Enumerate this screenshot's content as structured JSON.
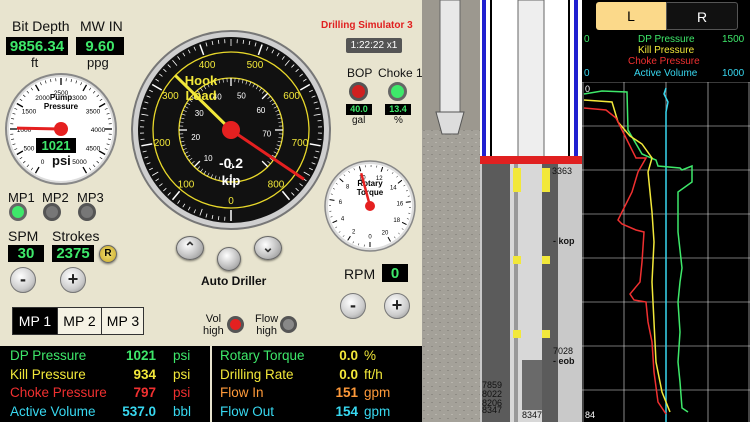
{
  "left": {
    "bit_depth_label": "Bit Depth",
    "bit_depth_value": "9856.34",
    "bit_depth_unit": "ft",
    "mw_label": "MW IN",
    "mw_value": "9.60",
    "mw_unit": "ppg",
    "pump_gauge_title": "Pump\nPressure",
    "pump_gauge_value": "1021",
    "pump_gauge_unit": "psi",
    "pump_ticks": [
      "0",
      "500",
      "1000",
      "1500",
      "2000",
      "2500",
      "3000",
      "3500",
      "4000",
      "4500",
      "5000"
    ],
    "pump_needle": 0.204,
    "mp_leds": [
      "MP1",
      "MP2",
      "MP3"
    ],
    "spm_label": "SPM",
    "spm_value": "30",
    "strokes_label": "Strokes",
    "strokes_value": "2375",
    "reset_label": "R",
    "minus": "-",
    "plus": "+",
    "mp_tabs": [
      "MP 1",
      "MP 2",
      "MP 3"
    ]
  },
  "hook": {
    "title": "Hook\nLoad",
    "value": "-0.2",
    "unit": "kip",
    "outer_ticks": [
      "0",
      "100",
      "200",
      "300",
      "400",
      "500",
      "600",
      "700",
      "800"
    ],
    "inner_ticks": [
      "0",
      "10",
      "20",
      "30",
      "40",
      "50",
      "60",
      "70"
    ],
    "needle_outer": 0.42,
    "needle_inner": 0.95,
    "auto_driller": "Auto Driller"
  },
  "header": {
    "sim_title": "Drilling Simulator 3",
    "clock": "1:22:22 x1"
  },
  "bop": {
    "bop_label": "BOP",
    "bop_value": "40.0",
    "bop_unit": "gal",
    "choke_label": "Choke 1",
    "choke_value": "13.4",
    "choke_unit": "%"
  },
  "rotary": {
    "title": "Rotary\nTorque",
    "ticks": [
      "0",
      "2",
      "4",
      "6",
      "8",
      "10",
      "12",
      "14",
      "16",
      "18",
      "20"
    ],
    "needle": 0.5,
    "rpm_label": "RPM",
    "rpm_value": "0"
  },
  "alarms": {
    "vol_high": "Vol\nhigh",
    "flow_high": "Flow\nhigh"
  },
  "readouts_left": [
    {
      "label": "DP Pressure",
      "value": "1021",
      "unit": "psi",
      "color": "#3ee86a"
    },
    {
      "label": "Kill Pressure",
      "value": "934",
      "unit": "psi",
      "color": "#f2e83a"
    },
    {
      "label": "Choke Pressure",
      "value": "797",
      "unit": "psi",
      "color": "#f03030"
    },
    {
      "label": "Active Volume",
      "value": "537.0",
      "unit": "bbl",
      "color": "#38d8f0"
    }
  ],
  "readouts_right": [
    {
      "label": "Rotary Torque",
      "value": "0.0",
      "unit": "%",
      "color": "#3ee86a",
      "vcolor": "#f2e83a"
    },
    {
      "label": "Drilling Rate",
      "value": "0.0",
      "unit": "ft/h",
      "color": "#f2e83a",
      "vcolor": "#f2e83a"
    },
    {
      "label": "Flow In",
      "value": "151",
      "unit": "gpm",
      "color": "#ff9a3a",
      "vcolor": "#ff9a3a"
    },
    {
      "label": "Flow Out",
      "value": "154",
      "unit": "gpm",
      "color": "#38d8f0",
      "vcolor": "#38d8f0"
    }
  ],
  "well": {
    "depth_top": "3363",
    "kop": "- kop",
    "depth_mid": "7028",
    "eob": "- eob",
    "depth_left": [
      "7859",
      "8022",
      "8206",
      "8347"
    ],
    "depth_bottom": "8347"
  },
  "trend": {
    "tab_l": "L",
    "tab_r": "R",
    "scale_left": "0",
    "scale_right": "1500",
    "legend": [
      {
        "name": "DP Pressure",
        "color": "#3ee86a"
      },
      {
        "name": "Kill Pressure",
        "color": "#f2e83a"
      },
      {
        "name": "Choke Pressure",
        "color": "#f03030"
      },
      {
        "name": "Active Volume",
        "color": "#38d8f0"
      }
    ],
    "vol_scale_left": "0",
    "vol_scale_right": "1000",
    "time_top": "0",
    "time_bottom": "84"
  }
}
